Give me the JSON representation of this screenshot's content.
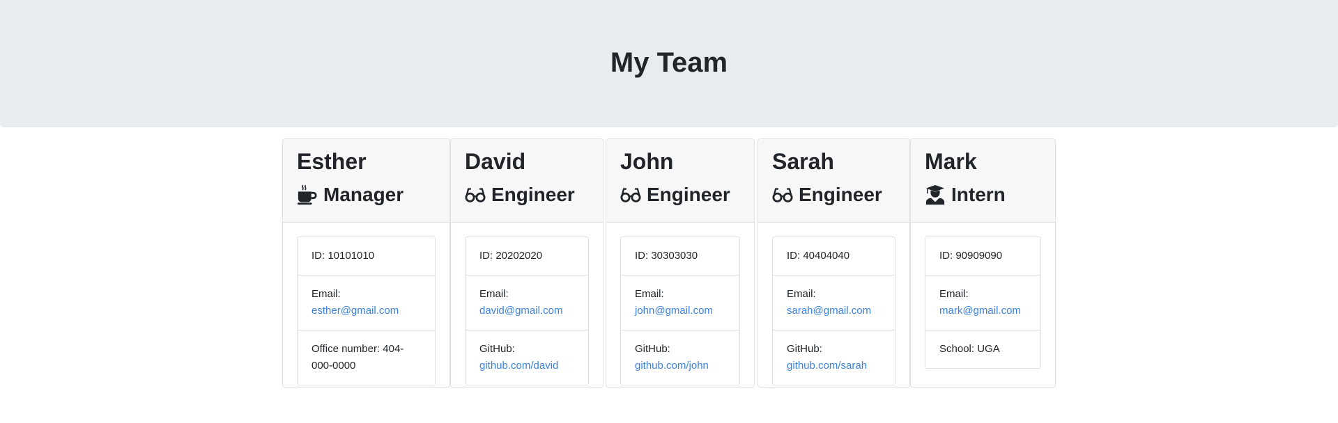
{
  "page": {
    "title": "My Team"
  },
  "icons": {
    "manager": "coffee-mug-icon",
    "engineer": "glasses-icon",
    "intern": "graduate-icon"
  },
  "colors": {
    "header_bg": "#e9ecef",
    "card_header_bg": "#f7f7f7",
    "link": "#3b82e0",
    "text": "#212529"
  },
  "team": [
    {
      "name": "Esther",
      "role": "Manager",
      "id_text": "ID: 10101010",
      "email_label": "Email:",
      "email": "esther@gmail.com",
      "extra_text": "Office number: 404-000-0000"
    },
    {
      "name": "David",
      "role": "Engineer",
      "id_text": "ID: 20202020",
      "email_label": "Email:",
      "email": "david@gmail.com",
      "extra_label": "GitHub:",
      "extra_link": "github.com/david"
    },
    {
      "name": "John",
      "role": "Engineer",
      "id_text": "ID: 30303030",
      "email_label": "Email:",
      "email": "john@gmail.com",
      "extra_label": "GitHub:",
      "extra_link": "github.com/john"
    },
    {
      "name": "Sarah",
      "role": "Engineer",
      "id_text": "ID: 40404040",
      "email_label": "Email:",
      "email": "sarah@gmail.com",
      "extra_label": "GitHub:",
      "extra_link": "github.com/sarah"
    },
    {
      "name": "Mark",
      "role": "Intern",
      "id_text": "ID: 90909090",
      "email_label": "Email:",
      "email": "mark@gmail.com",
      "extra_text": "School: UGA"
    }
  ]
}
